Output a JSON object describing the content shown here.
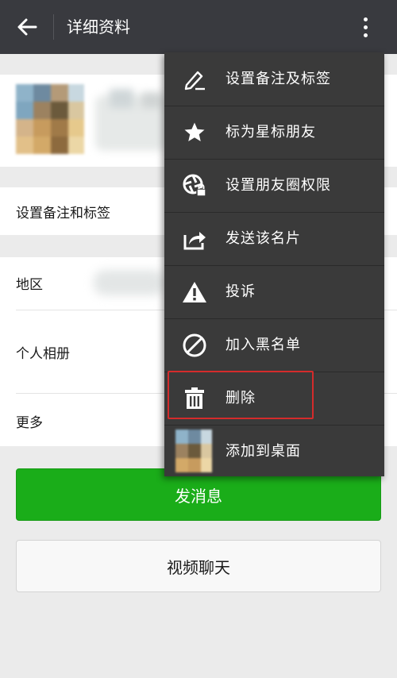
{
  "header": {
    "title": "详细资料",
    "bg_color": "#393a3f"
  },
  "rows": {
    "remark": "设置备注和标签",
    "region": "地区",
    "album": "个人相册",
    "more": "更多"
  },
  "buttons": {
    "send_message": "发消息",
    "video_chat": "视频聊天",
    "accent_color": "#1aad19"
  },
  "menu": {
    "highlight_color": "#d42b2b",
    "items": [
      {
        "label": "设置备注及标签",
        "icon": "pencil-icon"
      },
      {
        "label": "标为星标朋友",
        "icon": "star-icon"
      },
      {
        "label": "设置朋友圈权限",
        "icon": "moments-lock-icon"
      },
      {
        "label": "发送该名片",
        "icon": "share-icon"
      },
      {
        "label": "投诉",
        "icon": "warning-icon"
      },
      {
        "label": "加入黑名单",
        "icon": "block-icon"
      },
      {
        "label": "删除",
        "icon": "trash-icon"
      },
      {
        "label": "添加到桌面",
        "icon": "avatar-thumbnail"
      }
    ]
  }
}
